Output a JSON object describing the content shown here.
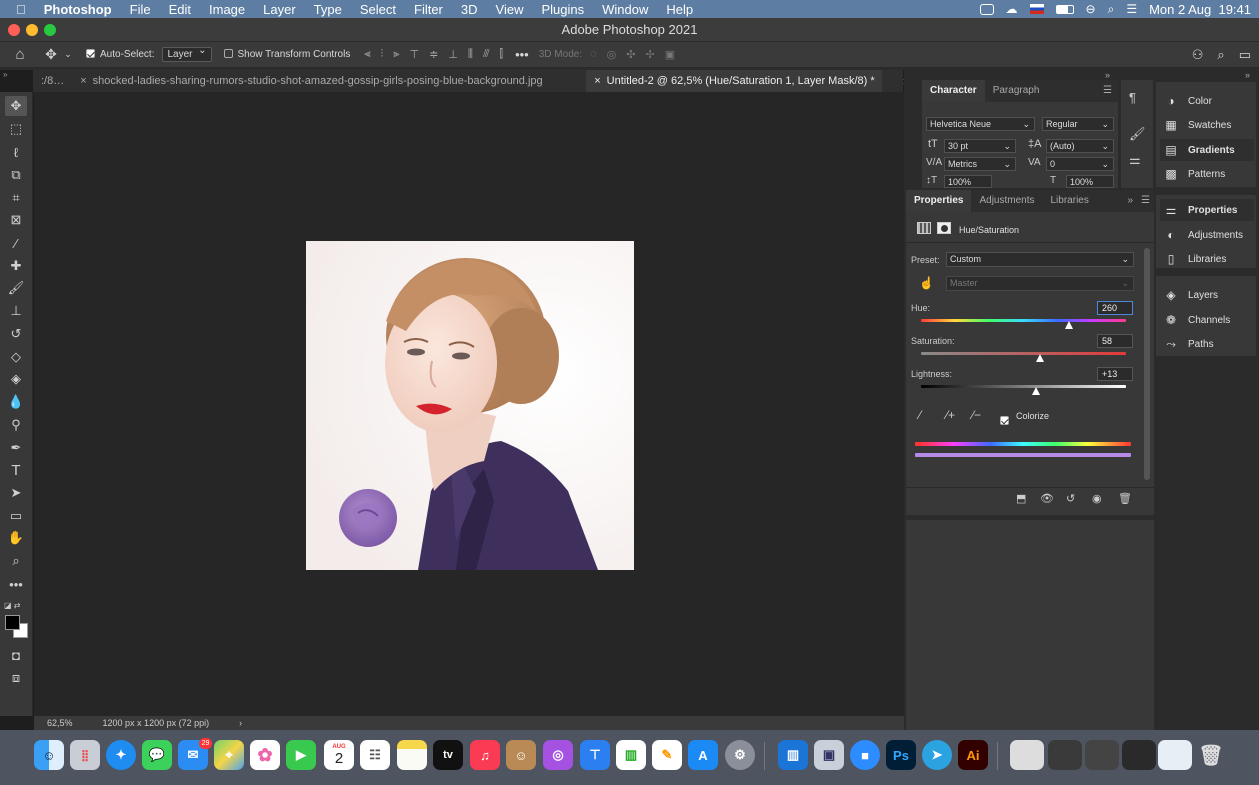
{
  "menubar": {
    "app": "Photoshop",
    "items": [
      "File",
      "Edit",
      "Image",
      "Layer",
      "Type",
      "Select",
      "Filter",
      "3D",
      "View",
      "Plugins",
      "Window",
      "Help"
    ],
    "clock": "Mon 2 Aug  19:41"
  },
  "window": {
    "title": "Adobe Photoshop 2021"
  },
  "options": {
    "auto_select_label": "Auto-Select:",
    "auto_select_value": "Layer",
    "transform_label": "Show Transform Controls",
    "mode3d_label": "3D Mode:"
  },
  "tabs": [
    {
      "label": ":/8…",
      "active": false
    },
    {
      "label": "shocked-ladies-sharing-rumors-studio-shot-amazed-gossip-girls-posing-blue-background.jpg",
      "active": false
    },
    {
      "label": "Untitled-2 @ 62,5% (Hue/Saturation 1, Layer Mask/8) *",
      "active": true
    }
  ],
  "status": {
    "zoom": "62,5%",
    "doc_info": "1200 px x 1200 px (72 ppi)"
  },
  "character": {
    "tabs": [
      "Character",
      "Paragraph"
    ],
    "font_family": "Helvetica Neue",
    "font_style": "Regular",
    "size": "30 pt",
    "leading": "(Auto)",
    "kerning": "Metrics",
    "tracking": "0",
    "vscale": "100%",
    "hscale": "100%"
  },
  "properties": {
    "tabs": [
      "Properties",
      "Adjustments",
      "Libraries"
    ],
    "title": "Hue/Saturation",
    "preset_label": "Preset:",
    "preset_value": "Custom",
    "channel_value": "Master",
    "hue_label": "Hue:",
    "hue_value": "260",
    "hue_fraction": 0.72,
    "sat_label": "Saturation:",
    "sat_value": "58",
    "sat_fraction": 0.58,
    "light_label": "Lightness:",
    "light_value": "+13",
    "light_fraction": 0.56,
    "colorize_label": "Colorize"
  },
  "right_panels": {
    "group1": [
      "Color",
      "Swatches",
      "Gradients",
      "Patterns"
    ],
    "group2": [
      "Properties",
      "Adjustments",
      "Libraries"
    ],
    "group3": [
      "Layers",
      "Channels",
      "Paths"
    ]
  },
  "dock": {
    "calendar_month": "AUG",
    "calendar_day": "2",
    "mail_badge": "29",
    "tv_label": "tv",
    "ps_label": "Ps",
    "ai_label": "Ai"
  },
  "colors": {
    "menubar": "#5d7ea2",
    "ps_blue": "#31a8ff",
    "ai_orange": "#ff9a00"
  }
}
